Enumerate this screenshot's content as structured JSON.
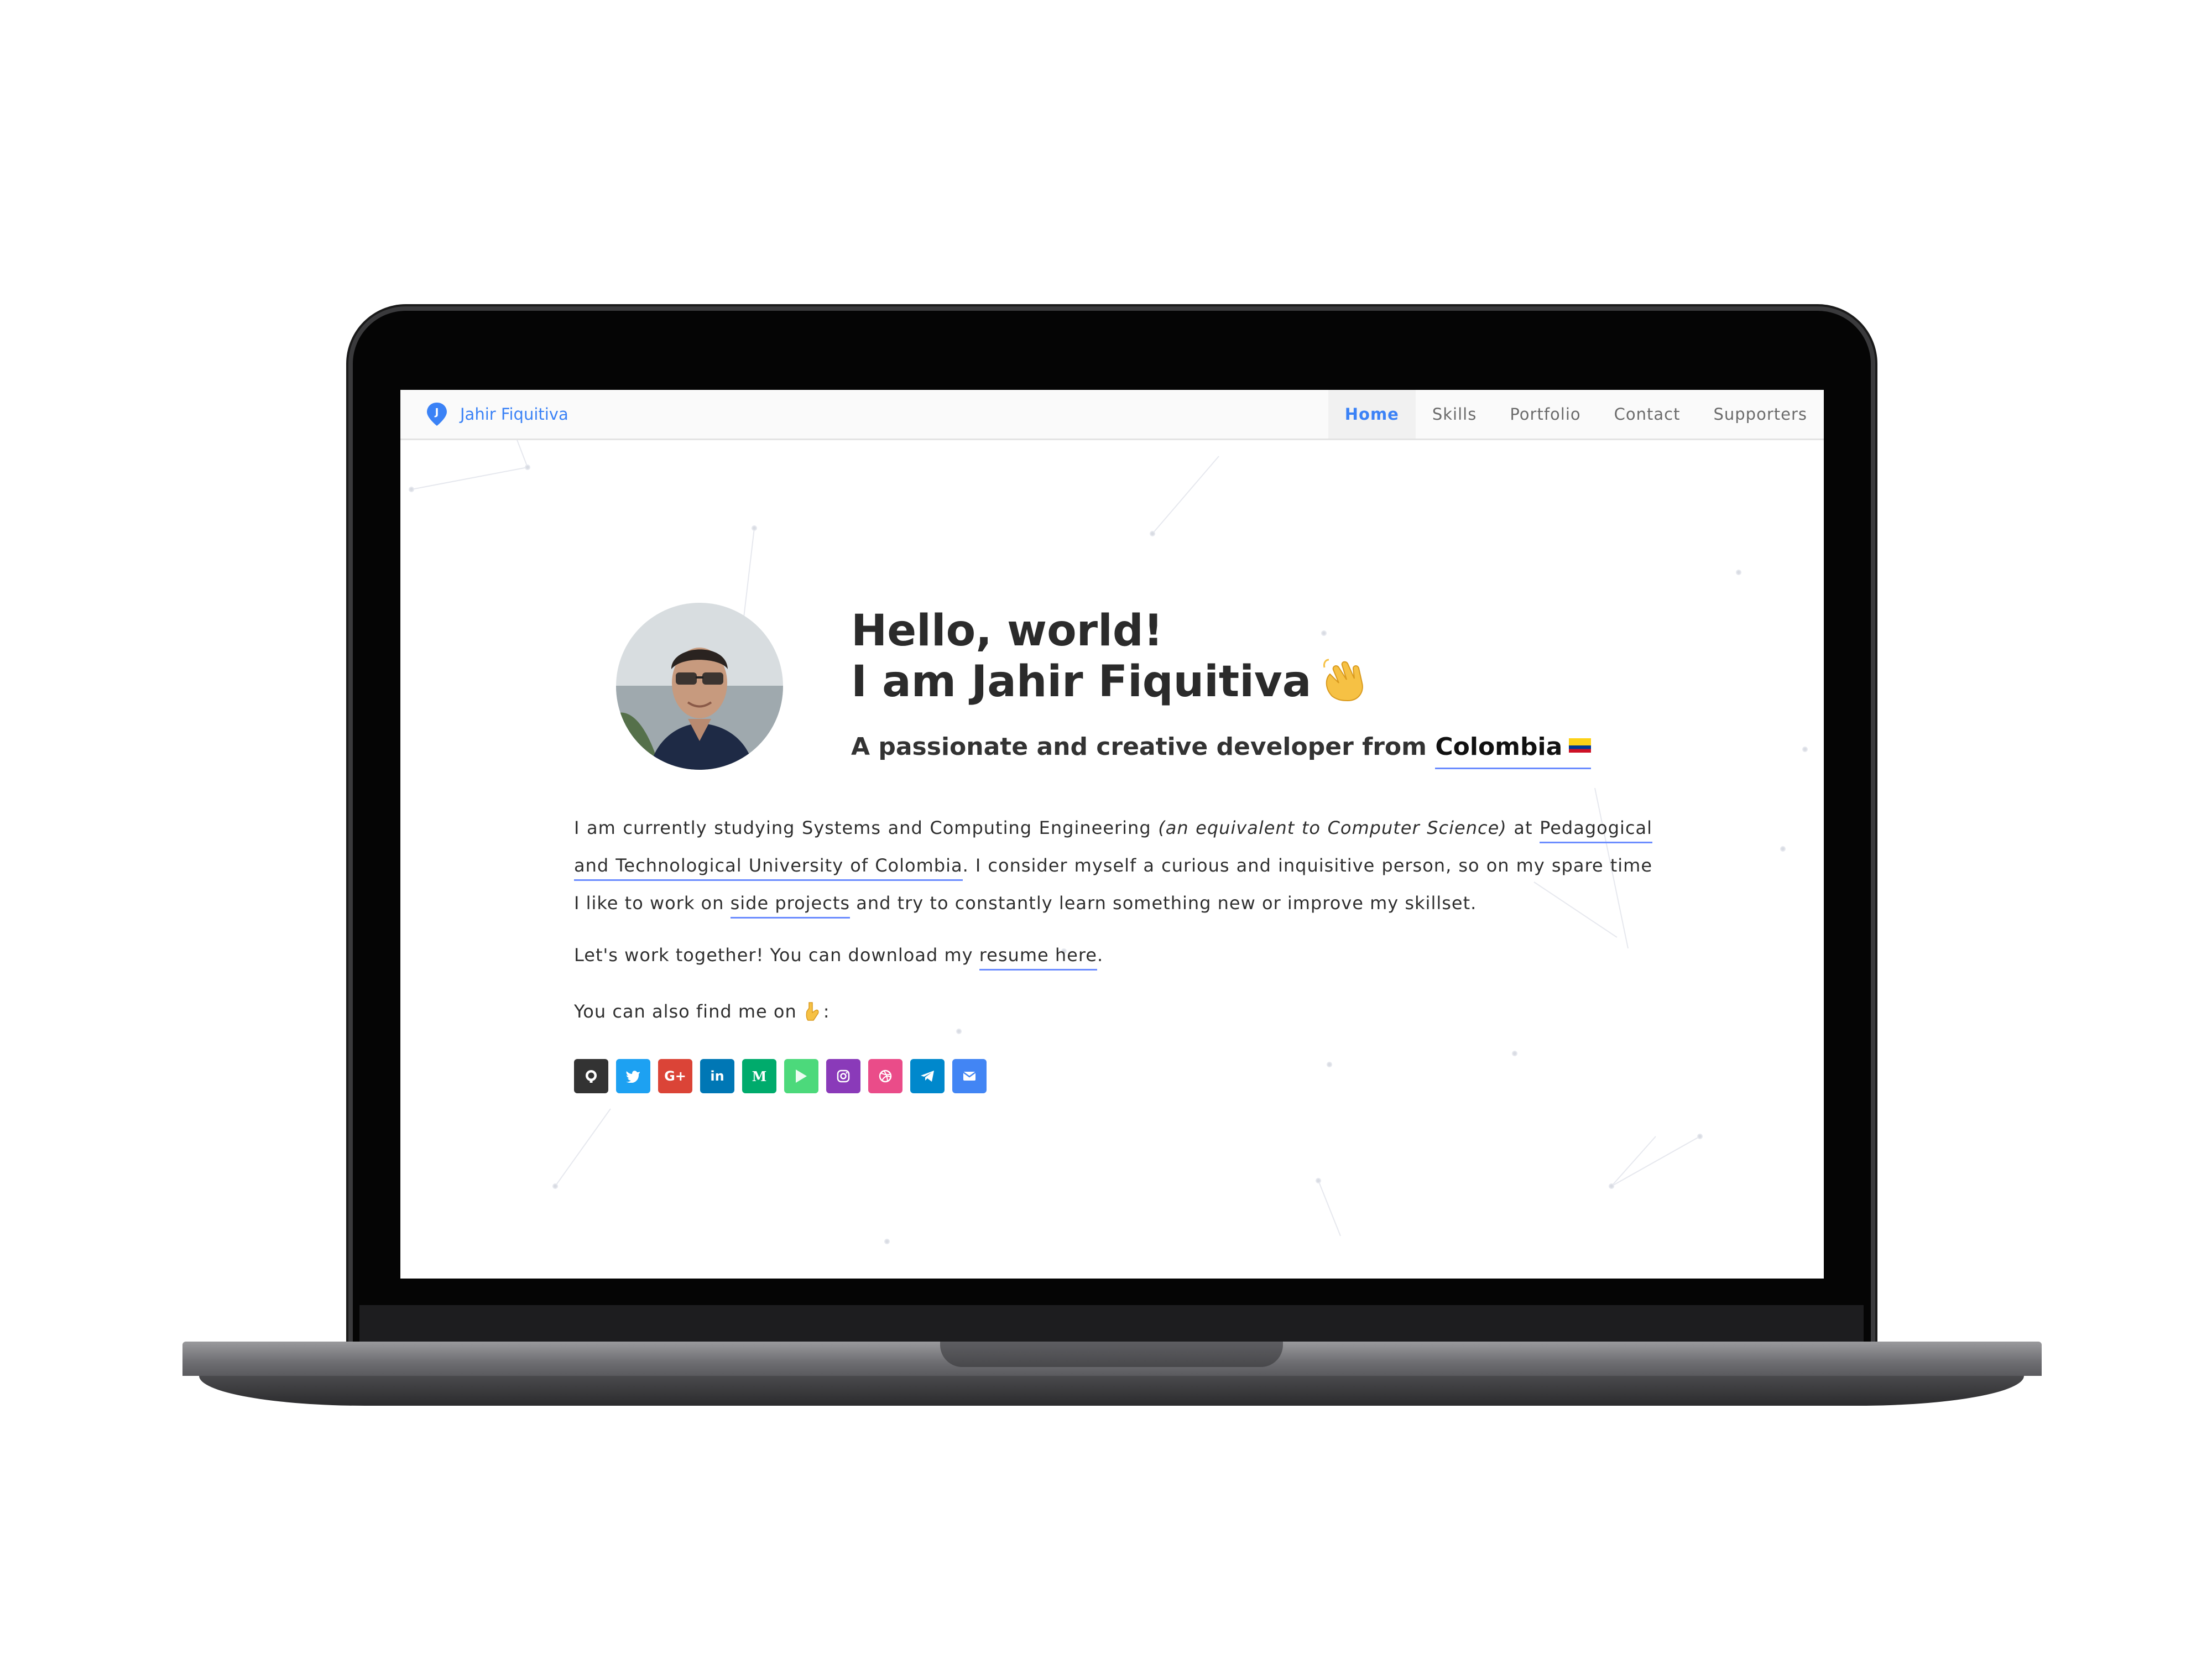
{
  "navbar": {
    "brand": "Jahir Fiquitiva",
    "links": [
      "Home",
      "Skills",
      "Portfolio",
      "Contact",
      "Supporters"
    ],
    "active": "Home",
    "accent": "#3b82f6"
  },
  "hero": {
    "greeting_line1": "Hello, world!",
    "greeting_line2": "I am Jahir Fiquitiva",
    "greeting_icon": "waving-hand-icon",
    "tagline_prefix": "A passionate and creative developer from",
    "country": "Colombia",
    "country_icon": "colombia-flag-icon"
  },
  "bio": {
    "part1": "I am currently studying Systems and Computing Engineering ",
    "italic": "(an equivalent to Computer Science)",
    "part2": " at ",
    "university": "Pedagogical and Technological University of Colombia",
    "part3": ". I consider myself a curious and inquisitive person, so on my spare time I like to work on ",
    "side_projects": "side projects",
    "part4": " and try to constantly learn something new or improve my skillset."
  },
  "resume": {
    "prefix": "Let's work together! You can download my ",
    "link": "resume here",
    "suffix": "."
  },
  "findme": {
    "text": "You can also find me on",
    "icon": "pointing-down-icon",
    "suffix": ":"
  },
  "socials": [
    {
      "name": "github",
      "label": "",
      "color": "#333333"
    },
    {
      "name": "twitter",
      "label": "",
      "color": "#1da1f2"
    },
    {
      "name": "google-plus",
      "label": "G+",
      "color": "#db4437"
    },
    {
      "name": "linkedin",
      "label": "in",
      "color": "#0077b5"
    },
    {
      "name": "medium",
      "label": "M",
      "color": "#00ab6c"
    },
    {
      "name": "google-play",
      "label": "",
      "color": "#4cd97b"
    },
    {
      "name": "instagram",
      "label": "",
      "color": "#8a3ab9"
    },
    {
      "name": "dribbble",
      "label": "",
      "color": "#ea4c89"
    },
    {
      "name": "telegram",
      "label": "",
      "color": "#0088cc"
    },
    {
      "name": "email",
      "label": "",
      "color": "#4285f4"
    }
  ]
}
